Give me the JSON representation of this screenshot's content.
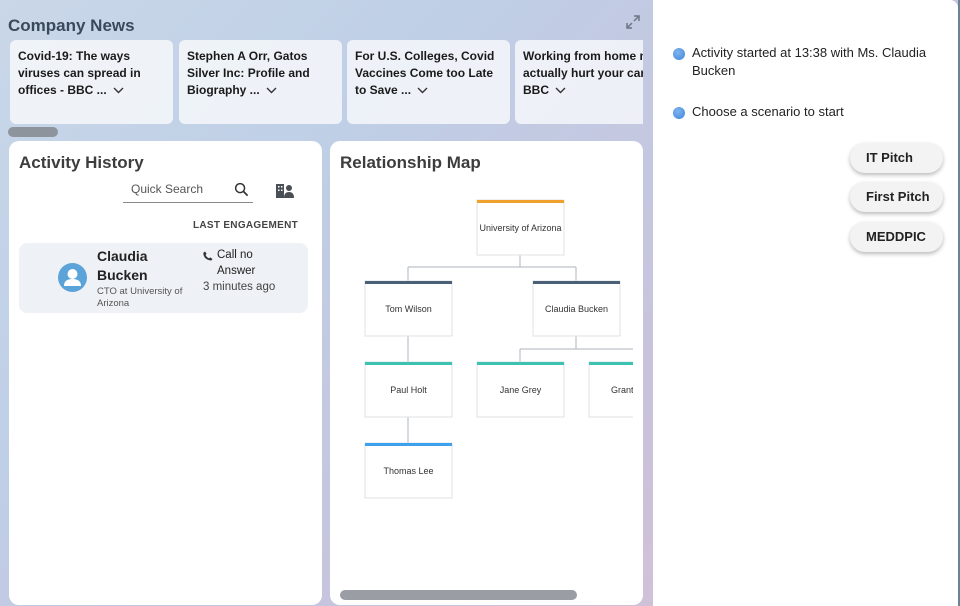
{
  "company_news": {
    "title": "Company News",
    "articles": [
      {
        "text": "Covid-19: The ways viruses can spread in offices - BBC ..."
      },
      {
        "text": "Stephen A Orr, Gatos Silver Inc: Profile and Biography ..."
      },
      {
        "text": "For U.S. Colleges, Covid Vaccines Come too Late to Save ..."
      },
      {
        "text": "Working from home may actually hurt your career - BBC"
      }
    ]
  },
  "activity_history": {
    "title": "Activity History",
    "search_placeholder": "Quick Search",
    "column_header": "LAST ENGAGEMENT",
    "rows": [
      {
        "name": "Claudia Bucken",
        "role": "CTO at University of Arizona",
        "engagement": "Call no Answer",
        "time": "3 minutes ago"
      }
    ]
  },
  "relationship_map": {
    "title": "Relationship Map",
    "nodes": {
      "root": "University of Arizona",
      "tom": "Tom Wilson",
      "claudia": "Claudia Bucken",
      "paul": "Paul Holt",
      "jane": "Jane Grey",
      "grant": "Grant",
      "thomas": "Thomas Lee"
    },
    "colors": {
      "root": "#f0a12c",
      "level1": "#4a6076",
      "level2": "#3cc2b3",
      "level3": "#3ea1ee"
    }
  },
  "assistant": {
    "messages": [
      "Activity started at 13:38 with Ms. Claudia Bucken",
      "Choose a scenario to start"
    ],
    "scenarios": [
      "IT Pitch",
      "First Pitch",
      "MEDDPIC"
    ]
  },
  "colors": {
    "accent": "#3d86d9",
    "avatar": "#5ca3d9"
  }
}
